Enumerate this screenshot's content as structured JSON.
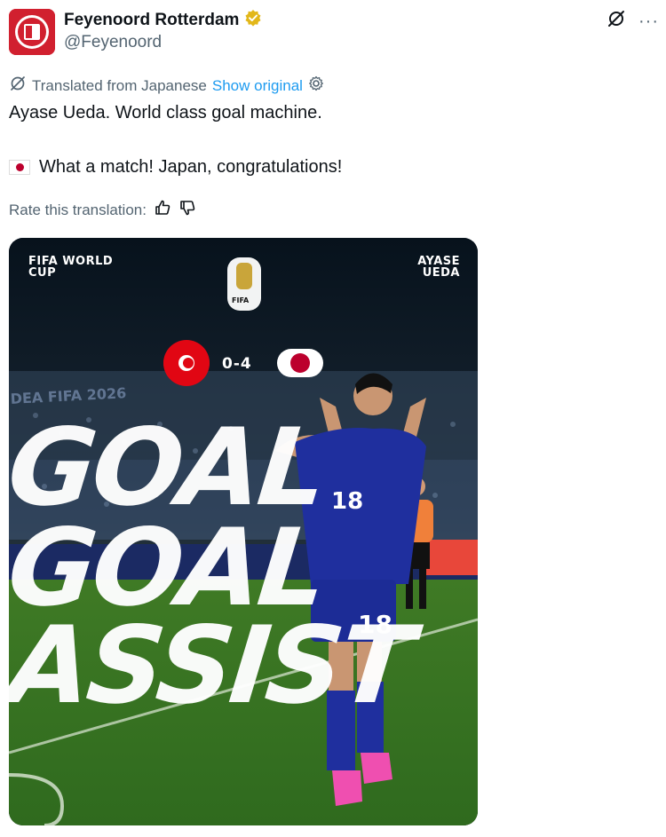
{
  "author": {
    "display_name": "Feyenoord Rotterdam",
    "handle": "@Feyenoord",
    "verified_icon": "verified-badge-icon",
    "brand_color": "#d1202f"
  },
  "translation": {
    "label": "Translated from Japanese",
    "show_original": "Show original",
    "rate_label": "Rate this translation:"
  },
  "tweet": {
    "line1": "Ayase Ueda. World class goal machine.",
    "line2": "What a match! Japan, congratulations!"
  },
  "media": {
    "left_caption_1": "FIFA WORLD",
    "left_caption_2": "CUP",
    "right_caption_1": "AYASE",
    "right_caption_2": "UEDA",
    "score": "0-4",
    "big_lines": [
      "GOAL",
      "GOAL",
      "ASSIST"
    ],
    "shirt_number": "18",
    "logo_text": "FIFA",
    "banner_text": "DEA FIFA 2026",
    "accent_colors": {
      "japan_blue": "#1f2f9e",
      "tunisia_red": "#e10613"
    }
  }
}
